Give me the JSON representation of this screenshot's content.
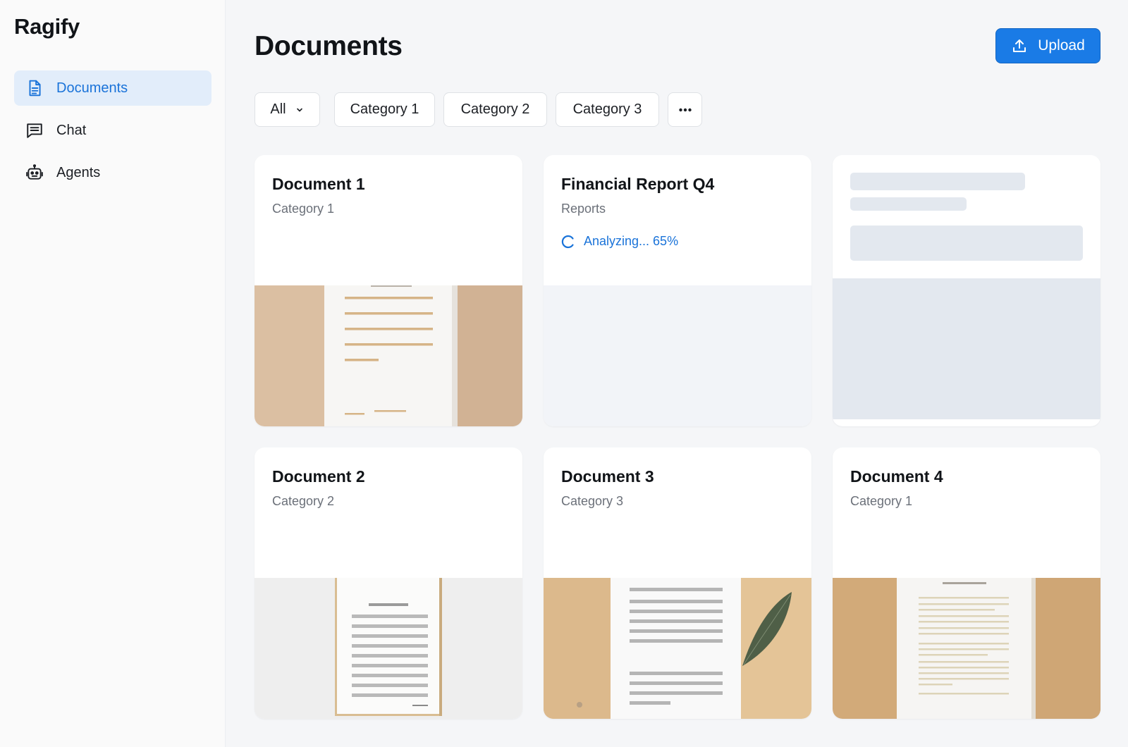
{
  "app": {
    "name": "Ragify"
  },
  "sidebar": {
    "items": [
      {
        "label": "Documents",
        "icon": "document-icon",
        "active": true
      },
      {
        "label": "Chat",
        "icon": "chat-icon",
        "active": false
      },
      {
        "label": "Agents",
        "icon": "robot-icon",
        "active": false
      }
    ]
  },
  "header": {
    "title": "Documents",
    "upload_label": "Upload"
  },
  "filters": {
    "all_label": "All",
    "chips": [
      "Category 1",
      "Category 2",
      "Category 3"
    ],
    "more_icon": "more-horizontal-icon"
  },
  "documents": [
    {
      "title": "Document 1",
      "category": "Category 1",
      "status": "ready"
    },
    {
      "title": "Financial Report Q4",
      "category": "Reports",
      "status": "analyzing",
      "status_text": "Analyzing... 65%",
      "progress_percent": 65
    },
    {
      "title": "",
      "category": "",
      "status": "loading"
    },
    {
      "title": "Document 2",
      "category": "Category 2",
      "status": "ready"
    },
    {
      "title": "Document 3",
      "category": "Category 3",
      "status": "ready"
    },
    {
      "title": "Document 4",
      "category": "Category 1",
      "status": "ready"
    }
  ],
  "colors": {
    "accent": "#1a7be6",
    "active_nav_bg": "#e2edfa",
    "skeleton": "#e3e8ef",
    "thumb_tan": "#dbbfa2",
    "thumb_sand": "#e4c497"
  }
}
